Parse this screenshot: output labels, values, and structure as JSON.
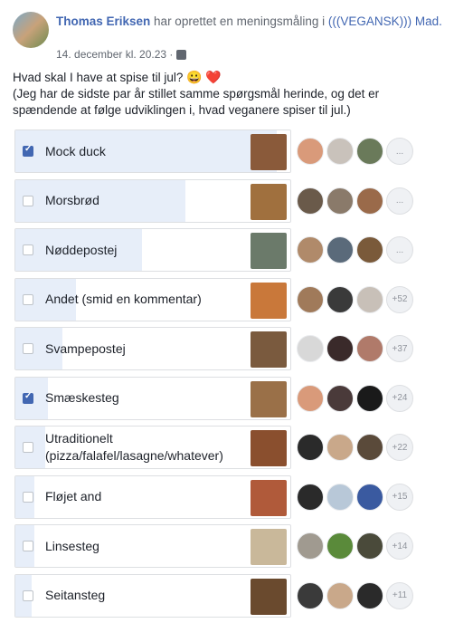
{
  "post": {
    "author": "Thomas Eriksen",
    "action": " har oprettet en meningsmåling i ",
    "group": "(((VEGANSK))) Mad.",
    "timestamp": "14. december kl. 20.23 ·",
    "question_line1": "Hvad skal I have at spise til jul? ",
    "question_emoji": "😀",
    "question_heart": "❤️",
    "question_line2": "(Jeg har de sidste par år stillet samme spørgsmål herinde, og det er spændende at følge udviklingen i, hvad veganere spiser til jul.)"
  },
  "poll": {
    "options": [
      {
        "label": "Mock duck",
        "checked": true,
        "share": 0.95,
        "more": "...",
        "thumb_color": "#8a5a3a"
      },
      {
        "label": "Morsbrød",
        "checked": false,
        "share": 0.62,
        "more": "...",
        "thumb_color": "#a0703e"
      },
      {
        "label": "Nøddepostej",
        "checked": false,
        "share": 0.46,
        "more": "...",
        "thumb_color": "#6b7a6a"
      },
      {
        "label": "Andet (smid en kommentar)",
        "checked": false,
        "share": 0.22,
        "more": "+52",
        "thumb_color": "#c9783a"
      },
      {
        "label": "Svampepostej",
        "checked": false,
        "share": 0.17,
        "more": "+37",
        "thumb_color": "#7a5a3e"
      },
      {
        "label": "Smæskesteg",
        "checked": true,
        "share": 0.12,
        "more": "+24",
        "thumb_color": "#9a7048"
      },
      {
        "label": "Utraditionelt (pizza/falafel/lasagne/whatever)",
        "checked": false,
        "share": 0.11,
        "more": "+22",
        "thumb_color": "#8a4f2e"
      },
      {
        "label": "Fløjet and",
        "checked": false,
        "share": 0.07,
        "more": "+15",
        "thumb_color": "#b05a3a"
      },
      {
        "label": "Linsesteg",
        "checked": false,
        "share": 0.07,
        "more": "+14",
        "thumb_color": "#c9b89a"
      },
      {
        "label": "Seitansteg",
        "checked": false,
        "share": 0.06,
        "more": "+11",
        "thumb_color": "#6a4a2e"
      }
    ]
  }
}
